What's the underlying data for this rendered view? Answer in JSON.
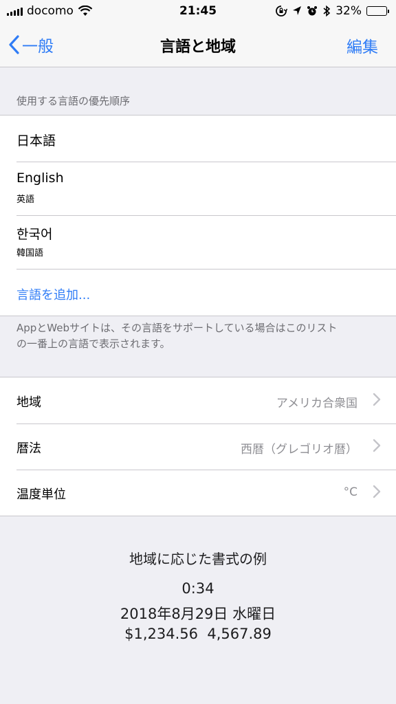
{
  "status_bar": {
    "carrier": "docomo",
    "time": "21:45",
    "battery_percent_text": "32%",
    "battery_level": 0.32,
    "icons": [
      "signal-icon",
      "wifi-icon",
      "orientation-lock-icon",
      "location-icon",
      "alarm-icon",
      "bluetooth-icon",
      "battery-icon"
    ]
  },
  "nav": {
    "back_label": "一般",
    "title": "言語と地域",
    "edit_label": "編集",
    "accent_color": "#2f7cf6"
  },
  "languages": {
    "header": "使用する言語の優先順序",
    "items": [
      {
        "name": "日本語",
        "sub": ""
      },
      {
        "name": "English",
        "sub": "英語"
      },
      {
        "name": "한국어",
        "sub": "韓国語"
      }
    ],
    "add_label": "言語を追加...",
    "footer_line1": "AppとWebサイトは、その言語をサポートしている場合はこのリスト",
    "footer_line2": "の一番上の言語で表示されます。"
  },
  "settings": [
    {
      "label": "地域",
      "value": "アメリカ合衆国"
    },
    {
      "label": "暦法",
      "value": "西暦（グレゴリオ暦）"
    },
    {
      "label": "温度単位",
      "value": "°C"
    }
  ],
  "format_example": {
    "title": "地域に応じた書式の例",
    "time": "0:34",
    "date": "2018年8月29日 水曜日",
    "numbers": "$1,234.56  4,567.89"
  }
}
